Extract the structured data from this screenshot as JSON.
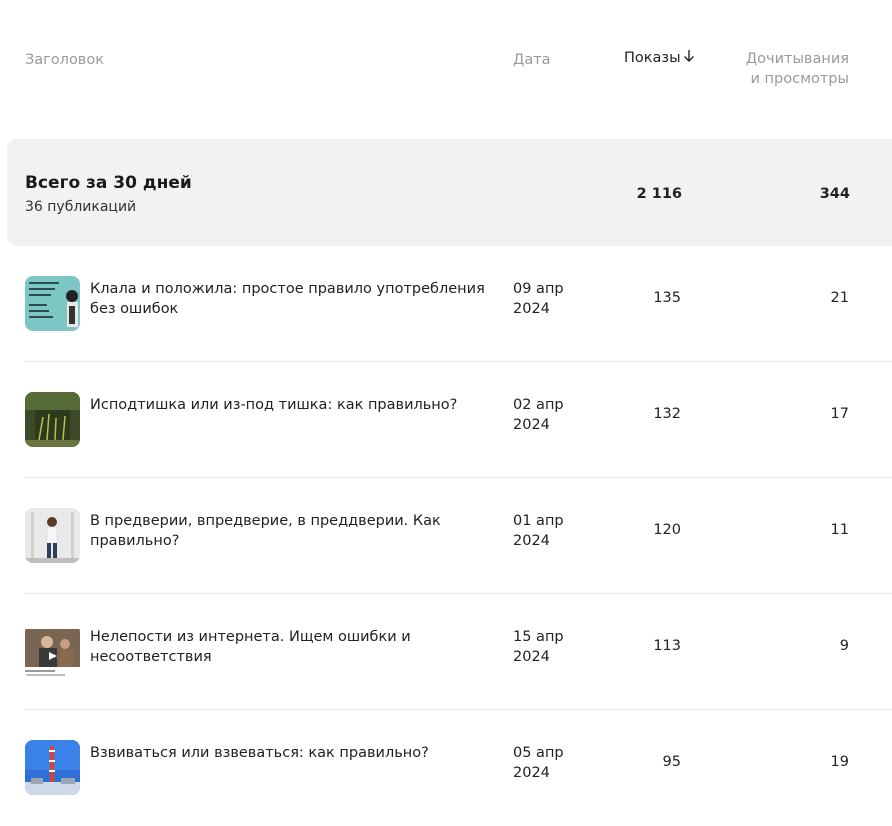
{
  "columns": {
    "title": "Заголовок",
    "date": "Дата",
    "views": "Показы",
    "views_sort_icon": "arrow-down-icon",
    "reads_line1": "Дочитывания",
    "reads_line2": "и просмотры"
  },
  "summary": {
    "title": "Всего за 30 дней",
    "subtitle": "36 публикаций",
    "views": "2 116",
    "reads": "344"
  },
  "rows": [
    {
      "title": "Клала и положила: простое правило употребления без ошибок",
      "date_line1": "09 апр",
      "date_line2": "2024",
      "views": "135",
      "reads": "21"
    },
    {
      "title": "Исподтишка или из-под тишка: как правильно?",
      "date_line1": "02 апр",
      "date_line2": "2024",
      "views": "132",
      "reads": "17"
    },
    {
      "title": "В предверии, впредверие, в преддверии. Как правильно?",
      "date_line1": "01 апр",
      "date_line2": "2024",
      "views": "120",
      "reads": "11"
    },
    {
      "title": "Нелепости из интернета. Ищем ошибки и несоответствия",
      "date_line1": "15 апр",
      "date_line2": "2024",
      "views": "113",
      "reads": "9"
    },
    {
      "title": "Взвиваться или взвеваться: как правильно?",
      "date_line1": "05 апр",
      "date_line2": "2024",
      "views": "95",
      "reads": "19"
    }
  ]
}
